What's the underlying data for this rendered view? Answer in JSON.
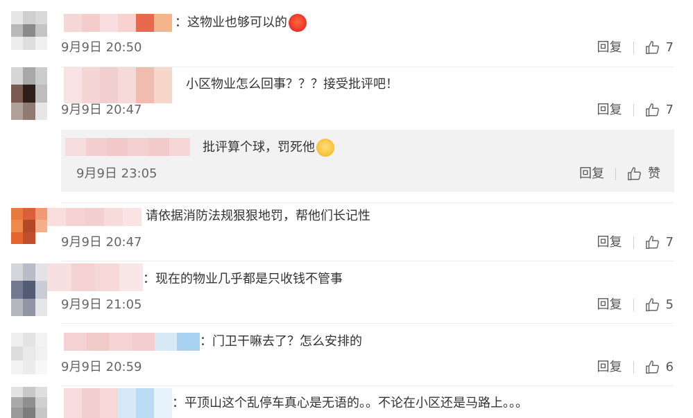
{
  "colors": {
    "text": "#333333",
    "time": "#666666",
    "reply_bg": "#f2f2f2",
    "divider": "#ececec"
  },
  "comments": [
    {
      "text": "：这物业也够可以的",
      "emoji": "angry-face-icon",
      "time": "9月9日 20:50",
      "reply_label": "回复",
      "likes": "7"
    },
    {
      "text": "小区物业怎么回事？？？接受批评吧！",
      "time": "9月9日 20:47",
      "reply_label": "回复",
      "likes": "7",
      "reply": {
        "text": "批评算个球，罚死他",
        "emoji": "laugh-cry-icon",
        "time": "9月9日 23:05",
        "reply_label": "回复",
        "likes": "赞"
      }
    },
    {
      "text": "请依据消防法规狠狠地罚，帮他们长记性",
      "time": "9月9日 20:47",
      "reply_label": "回复",
      "likes": "7"
    },
    {
      "text": "：现在的物业几乎都是只收钱不管事",
      "time": "9月9日 21:05",
      "reply_label": "回复",
      "likes": "5"
    },
    {
      "text": "：门卫干嘛去了？怎么安排的",
      "time": "9月9日 20:59",
      "reply_label": "回复",
      "likes": "6"
    },
    {
      "text": "：平顶山这个乱停车真心是无语的。。不论在小区还是马路上。。。"
    }
  ]
}
